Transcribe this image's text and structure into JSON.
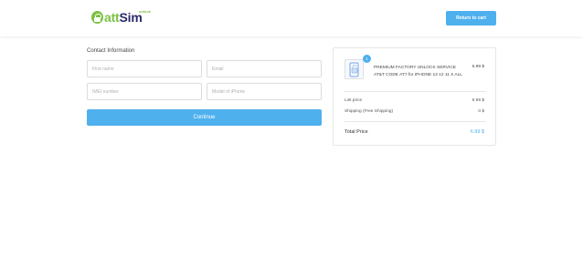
{
  "header": {
    "logo": {
      "part1": "att",
      "part2": "Sim",
      "sub": "unlock"
    },
    "return_label": "Return to cart"
  },
  "form": {
    "section_title": "Contact Information",
    "first_name_placeholder": "First name",
    "email_placeholder": "Email",
    "imei_placeholder": "IMEI number",
    "model_placeholder": "Model of iPhone",
    "continue_label": "Continue"
  },
  "summary": {
    "item": {
      "quantity": "1",
      "name": "PREMIUM FACTORY UNLOCK SERVICE AT&T CODE AT7 for IPHONE 13 12 11 X ALL",
      "price": "6.99 $"
    },
    "list_price_label": "List price",
    "list_price_value": "6.99 $",
    "shipping_label": "Shipping (Free Shipping)",
    "shipping_value": "0 $",
    "total_label": "Total Price",
    "total_value": "6.99 $"
  },
  "colors": {
    "accent": "#4fb0ee",
    "brand_green": "#7bc142",
    "brand_navy": "#2b2b6b"
  }
}
